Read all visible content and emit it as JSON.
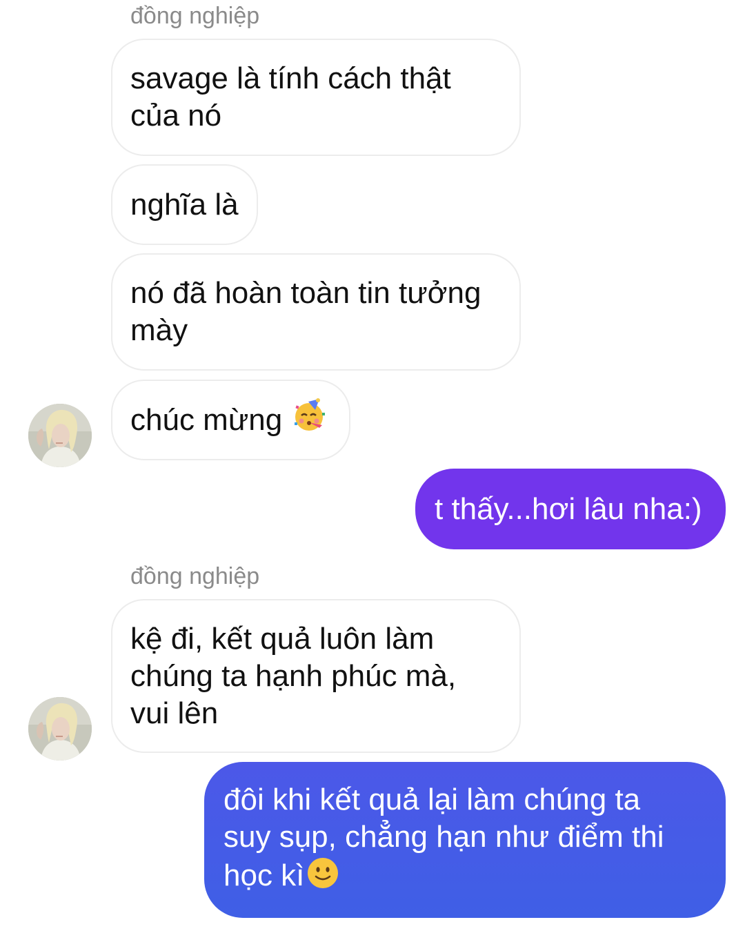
{
  "conversation": {
    "messages": [
      {
        "sender_label": "đồng nghiệp",
        "text": "savage là tính cách thật\ncủa nó"
      },
      {
        "text": "nghĩa là"
      },
      {
        "text": "nó đã hoàn toàn tin tưởng\nmày"
      },
      {
        "text": "chúc mừng",
        "emoji": "partying-face-icon"
      },
      {
        "text": "t thấy...hơi lâu nha:)",
        "outgoing": true
      },
      {
        "sender_label": "đồng nghiệp",
        "text": "kệ đi, kết quả luôn làm\nchúng ta hạnh phúc mà,\nvui lên"
      },
      {
        "text": "đôi khi kết quả lại làm chúng ta\nsuy sụp, chẳng hạn như điểm thi\nhọc kì",
        "emoji": "slightly-smiling-face-icon",
        "outgoing": true
      }
    ]
  },
  "colors": {
    "outgoing_top": "#7235ec",
    "outgoing_bottom": "#3f5fe6",
    "incoming_border": "#ececec",
    "sender_label": "#8a8a8a"
  }
}
